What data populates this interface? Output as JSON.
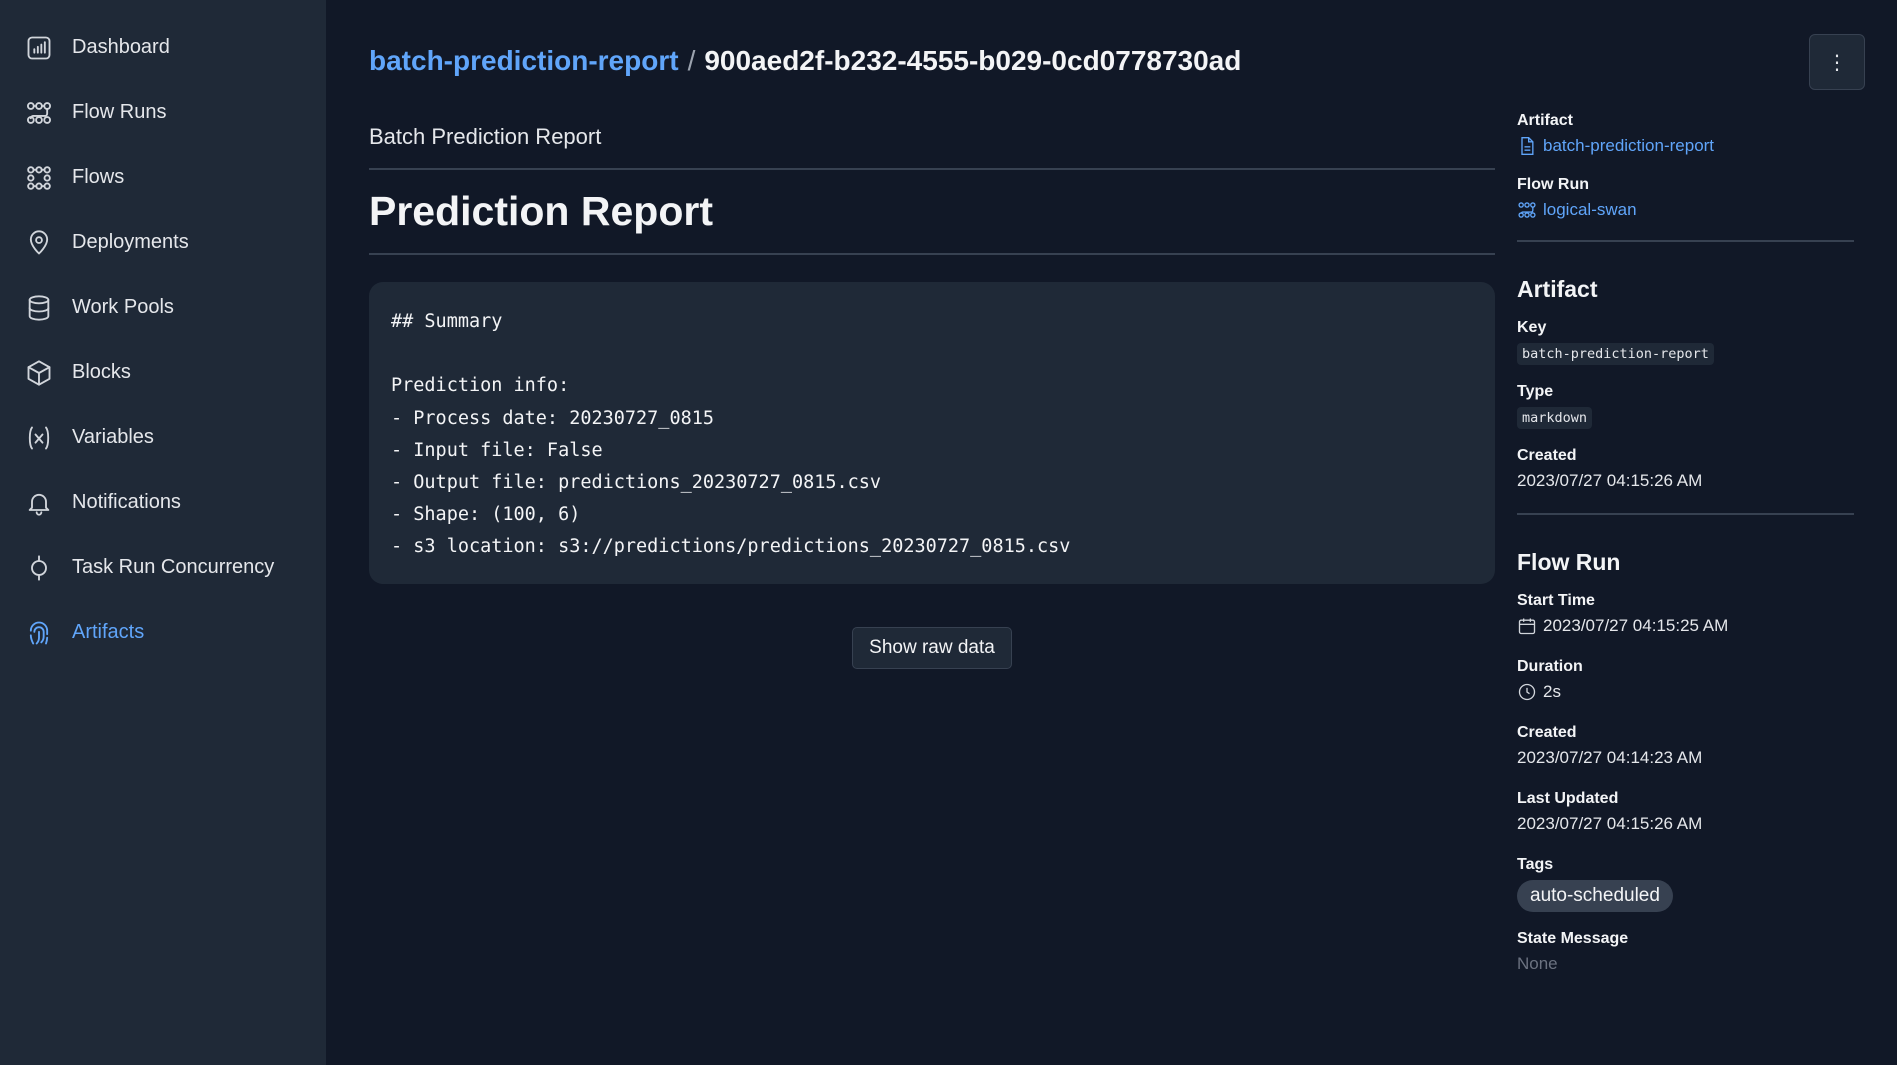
{
  "sidebar": {
    "items": [
      {
        "label": "Dashboard",
        "icon": "dashboard-icon"
      },
      {
        "label": "Flow Runs",
        "icon": "flow-runs-icon"
      },
      {
        "label": "Flows",
        "icon": "flows-icon"
      },
      {
        "label": "Deployments",
        "icon": "location-pin-icon"
      },
      {
        "label": "Work Pools",
        "icon": "database-icon"
      },
      {
        "label": "Blocks",
        "icon": "cube-icon"
      },
      {
        "label": "Variables",
        "icon": "variable-x-icon"
      },
      {
        "label": "Notifications",
        "icon": "bell-icon"
      },
      {
        "label": "Task Run Concurrency",
        "icon": "concurrency-icon"
      },
      {
        "label": "Artifacts",
        "icon": "fingerprint-icon",
        "active": true
      }
    ]
  },
  "header": {
    "artifact_key": "batch-prediction-report",
    "separator": "/",
    "artifact_id": "900aed2f-b232-4555-b029-0cd0778730ad",
    "menu_label": "⋮"
  },
  "main": {
    "description": "Batch Prediction Report",
    "report_title": "Prediction Report",
    "code_lines": [
      "## Summary",
      "",
      "Prediction info:",
      "- Process date: 20230727_0815",
      "- Input file: False",
      "- Output file: predictions_20230727_0815.csv",
      "- Shape: (100, 6)",
      "- s3 location: s3://predictions/predictions_20230727_0815.csv"
    ],
    "raw_button": "Show raw data"
  },
  "panel": {
    "artifact_label": "Artifact",
    "artifact_link": "batch-prediction-report",
    "flow_run_label": "Flow Run",
    "flow_run_link": "logical-swan",
    "artifact_section": {
      "title": "Artifact",
      "key_label": "Key",
      "key_value": "batch-prediction-report",
      "type_label": "Type",
      "type_value": "markdown",
      "created_label": "Created",
      "created_value": "2023/07/27 04:15:26 AM"
    },
    "flow_run_section": {
      "title": "Flow Run",
      "start_label": "Start Time",
      "start_value": "2023/07/27 04:15:25 AM",
      "duration_label": "Duration",
      "duration_value": "2s",
      "created_label": "Created",
      "created_value": "2023/07/27 04:14:23 AM",
      "updated_label": "Last Updated",
      "updated_value": "2023/07/27 04:15:26 AM",
      "tags_label": "Tags",
      "tag": "auto-scheduled",
      "state_label": "State Message",
      "state_value": "None"
    }
  },
  "colors": {
    "accent": "#60a5fa",
    "background": "#111827",
    "sidebar": "#1f2937"
  }
}
